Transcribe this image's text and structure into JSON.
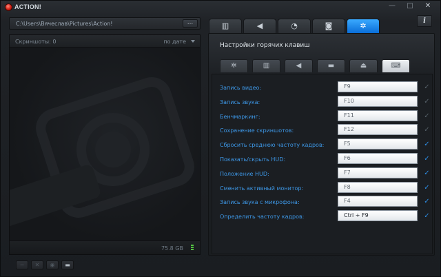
{
  "window": {
    "title": "ACTION!",
    "controls": [
      {
        "name": "minimize-button",
        "icon": "minimize-icon",
        "glyph": "—"
      },
      {
        "name": "maximize-button",
        "icon": "maximize-icon",
        "glyph": "□"
      },
      {
        "name": "close-button",
        "icon": "close-icon",
        "glyph": "✕"
      }
    ]
  },
  "left": {
    "path": "C:\\Users\\Вячеслав\\Pictures\\Action!",
    "browse_label": "...",
    "screenshots_label": "Скриншоты: 0",
    "sort_label": "по дате",
    "disk_free": "75.8 GB",
    "bottom_buttons": [
      {
        "name": "delete-button",
        "icon": "minus-icon",
        "glyph": "−",
        "active": false
      },
      {
        "name": "remove-button",
        "icon": "close-icon",
        "glyph": "✕",
        "active": false
      },
      {
        "name": "view-button",
        "icon": "eye-icon",
        "glyph": "◉",
        "active": false
      },
      {
        "name": "open-folder-button",
        "icon": "folder-icon",
        "glyph": "▬",
        "active": true
      }
    ]
  },
  "right": {
    "main_tabs": [
      {
        "name": "tab-video",
        "icon": "film-icon",
        "glyph": "▥",
        "active": false
      },
      {
        "name": "tab-audio",
        "icon": "speaker-icon",
        "glyph": "◀",
        "active": false
      },
      {
        "name": "tab-benchmark",
        "icon": "stopwatch-icon",
        "glyph": "◔",
        "active": false
      },
      {
        "name": "tab-screenshots",
        "icon": "camera-icon",
        "glyph": "◙",
        "active": false
      },
      {
        "name": "tab-settings",
        "icon": "gear-icon",
        "glyph": "✲",
        "active": true
      }
    ],
    "info_label": "i",
    "section_title": "Настройки горячих клавиш",
    "sub_tabs": [
      {
        "name": "subtab-general",
        "icon": "gear-icon",
        "glyph": "✲",
        "active": false
      },
      {
        "name": "subtab-video",
        "icon": "film-icon",
        "glyph": "▥",
        "active": false
      },
      {
        "name": "subtab-audio",
        "icon": "speaker-icon",
        "glyph": "◀",
        "active": false
      },
      {
        "name": "subtab-monitor",
        "icon": "monitor-icon",
        "glyph": "▬",
        "active": false
      },
      {
        "name": "subtab-upload",
        "icon": "upload-icon",
        "glyph": "⏏",
        "active": false
      },
      {
        "name": "subtab-hotkeys",
        "icon": "keyboard-icon",
        "glyph": "⌨",
        "active": true
      }
    ],
    "hotkeys": [
      {
        "label": "Запись видео:",
        "key": "F9",
        "enabled": false
      },
      {
        "label": "Запись звука:",
        "key": "F10",
        "enabled": false
      },
      {
        "label": "Бенчмаркинг:",
        "key": "F11",
        "enabled": false
      },
      {
        "label": "Сохранение скриншотов:",
        "key": "F12",
        "enabled": false
      },
      {
        "label": "Сбросить среднюю частоту кадров:",
        "key": "F5",
        "enabled": true
      },
      {
        "label": "Показать/скрыть HUD:",
        "key": "F6",
        "enabled": true
      },
      {
        "label": "Положение HUD:",
        "key": "F7",
        "enabled": true
      },
      {
        "label": "Сменить активный монитор:",
        "key": "F8",
        "enabled": true
      },
      {
        "label": "Запись звука с микрофона:",
        "key": "F4",
        "enabled": true
      },
      {
        "label": "Определить частоту кадров:",
        "key": "Ctrl + F9",
        "enabled": true
      }
    ]
  },
  "colors": {
    "accent": "#1a86f0",
    "label_blue": "#3d97e6",
    "disk_green": "#53c142"
  }
}
